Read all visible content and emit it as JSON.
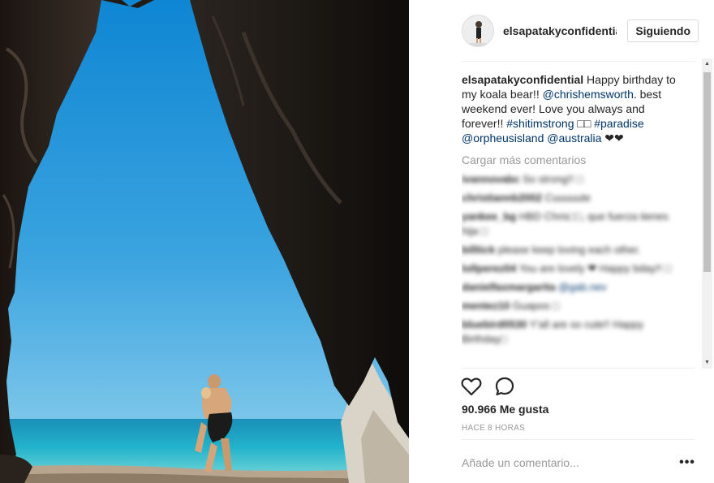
{
  "post": {
    "username": "elsapatakyconfidential",
    "follow_label": "Siguiendo",
    "caption": {
      "username": "elsapatakyconfidential",
      "text_1": " Happy birthday to my koala bear!! ",
      "mention_1": "@chrishemsworth",
      "text_2": ". best weekend ever! Love you always and forever!! ",
      "hashtag_1": "#shitimstrong",
      "text_3": " □□ ",
      "hashtag_2": "#paradise",
      "text_4": " ",
      "mention_2": "@orpheusisland",
      "text_5": " ",
      "mention_3": "@australia",
      "text_6": " ❤❤"
    },
    "load_more_label": "Cargar más comentarios",
    "comments": [
      {
        "user": "ivannovabc",
        "text": " So strong!! □"
      },
      {
        "user": "christiannb2002",
        "text": " Cuuuuute"
      },
      {
        "user": "yankee_bg",
        "text": " HBD Chris□□, que fuerza tienes hija □"
      },
      {
        "user": "billtick",
        "text": " please keep loving each other."
      },
      {
        "user": "lollperez04",
        "text": " You are lovely ❤ Happy bday!! □"
      },
      {
        "user": "danielfaxmargarita",
        "text": " @gab.nev"
      },
      {
        "user": "mentez10",
        "text": " Guapos □"
      },
      {
        "user": "bluebird0530",
        "text": " Y'all are so cute!! Happy Birthday□"
      }
    ],
    "likes_label": "90.966 Me gusta",
    "timestamp": "HACE 8 HORAS",
    "comment_placeholder": "Añade un comentario...",
    "more_options_label": "•••"
  },
  "icons": {
    "like": "heart-icon",
    "comment": "comment-bubble-icon",
    "scroll_up": "scroll-up-arrow-icon",
    "scroll_down": "scroll-down-arrow-icon"
  },
  "colors": {
    "link": "#003569",
    "muted": "#999999",
    "text": "#262626",
    "sky": "#1f97d8",
    "sea": "#1aa7c9"
  }
}
